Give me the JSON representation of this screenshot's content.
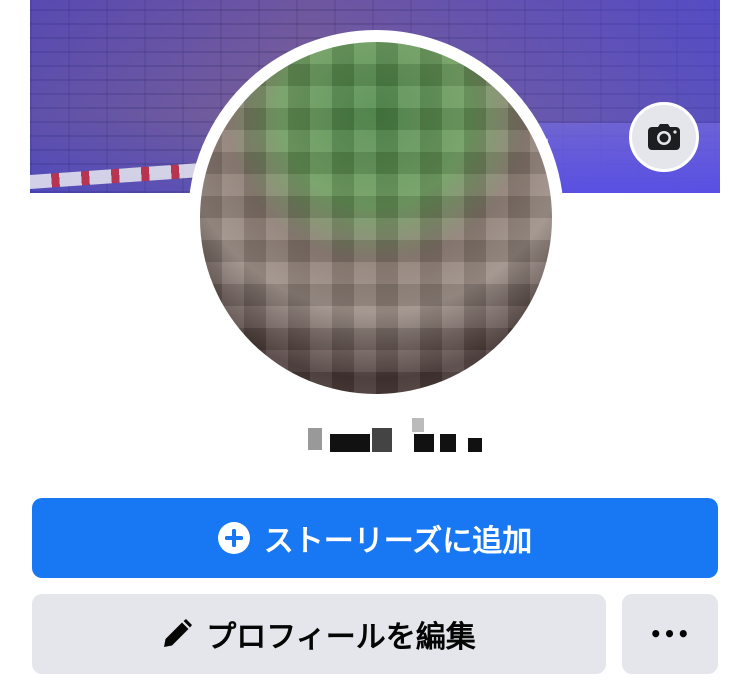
{
  "cover": {
    "camera_icon": "camera-icon"
  },
  "profile": {
    "name_obscured": true
  },
  "buttons": {
    "add_story": {
      "label": "ストーリーズに追加",
      "icon": "plus-circle-icon",
      "color": "#1877f2"
    },
    "edit_profile": {
      "label": "プロフィールを編集",
      "icon": "pencil-icon",
      "color": "#e4e6eb"
    },
    "more": {
      "label": "•••",
      "icon": "more-icon"
    }
  }
}
